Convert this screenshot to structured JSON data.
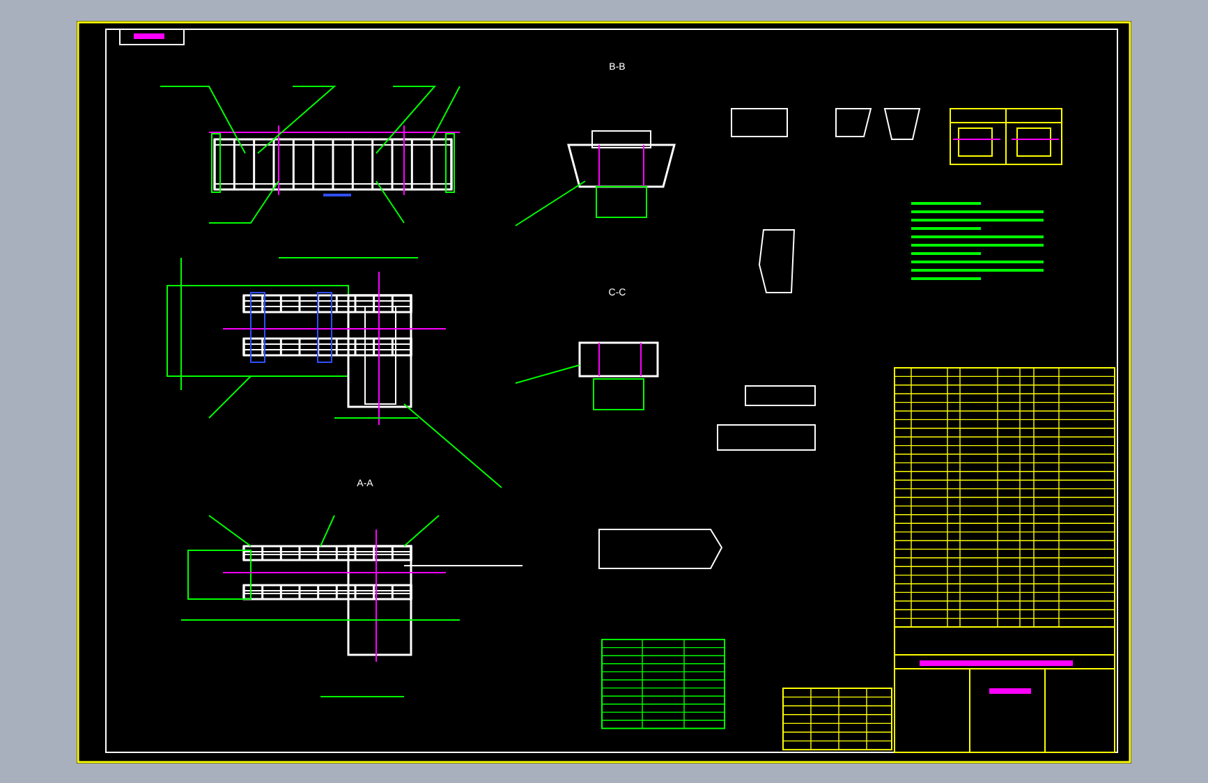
{
  "drawing": {
    "view_labels": [
      {
        "label": "B-B"
      },
      {
        "label": "C-C"
      },
      {
        "label": "A-A"
      }
    ]
  }
}
